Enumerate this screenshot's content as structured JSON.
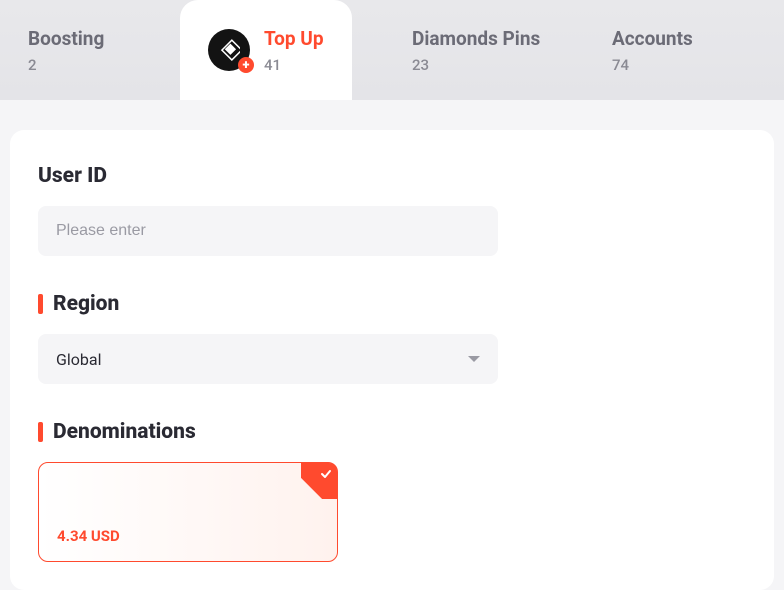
{
  "tabs": [
    {
      "label": "Boosting",
      "count": "2"
    },
    {
      "label": "Top Up",
      "count": "41"
    },
    {
      "label": "Diamonds Pins",
      "count": "23"
    },
    {
      "label": "Accounts",
      "count": "74"
    }
  ],
  "user_id": {
    "title": "User ID",
    "placeholder": "Please enter",
    "value": ""
  },
  "region": {
    "title": "Region",
    "value": "Global"
  },
  "denominations": {
    "title": "Denominations",
    "items": [
      {
        "price": "4.34 USD",
        "selected": true
      }
    ]
  }
}
